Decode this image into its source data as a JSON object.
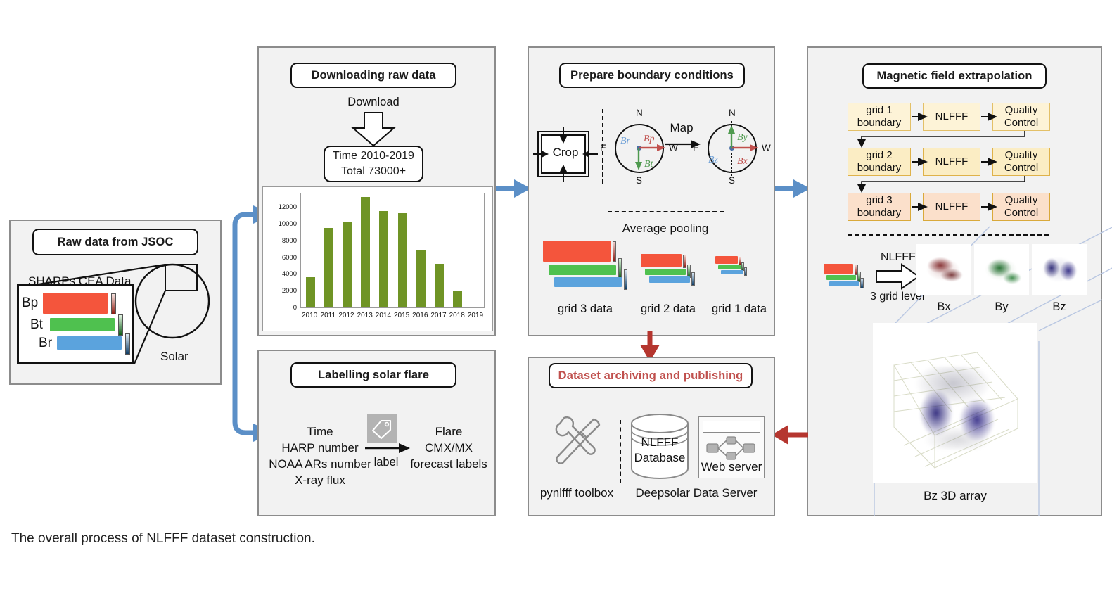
{
  "caption": "The overall process of NLFFF dataset construction.",
  "colors": {
    "panel_bg": "#f2f2f2",
    "panel_border": "#8c8c8c",
    "blue_arrow": "#5b8fc7",
    "red_arrow": "#b5362f",
    "bar_green": "#6f9425",
    "title_red": "#c0504d",
    "grid1_fill": "#fdf3d7",
    "grid2_fill": "#fbedc4",
    "grid3_fill": "#fbe0cb",
    "grid_border": "#d9a93a",
    "band_bp": "#f4553c",
    "band_bt": "#4fc14f",
    "band_br": "#5ba3dd"
  },
  "panels": {
    "raw": {
      "title": "Raw data from JSOC",
      "subtitle": "SHARPs CEA Data",
      "bands": [
        "Bp",
        "Bt",
        "Br"
      ],
      "solar_label": "Solar"
    },
    "download": {
      "title": "Downloading raw data",
      "arrow_label": "Download",
      "summary_line1": "Time 2010-2019",
      "summary_line2": "Total  73000+"
    },
    "boundary": {
      "title": "Prepare boundary conditions",
      "crop_label": "Crop",
      "map_label": "Map",
      "pooling_label": "Average pooling",
      "compass_left": {
        "north": "N",
        "south": "S",
        "east": "E",
        "west": "W",
        "v_up": "Br",
        "v_right": "Bp",
        "v_down": "Bt"
      },
      "compass_right": {
        "north": "N",
        "south": "S",
        "east": "E",
        "west": "W",
        "v_up": "By",
        "v_right": "Bx",
        "v_down": "Bz"
      },
      "grid_labels": [
        "grid 3 data",
        "grid 2 data",
        "grid 1 data"
      ]
    },
    "extrapolation": {
      "title": "Magnetic field extrapolation",
      "rows": [
        {
          "boundary": "grid 1\nboundary",
          "boundary_l1": "grid 1",
          "boundary_l2": "boundary",
          "method": "NLFFF",
          "qc_l1": "Quality",
          "qc_l2": "Control"
        },
        {
          "boundary_l1": "grid 2",
          "boundary_l2": "boundary",
          "method": "NLFFF",
          "qc_l1": "Quality",
          "qc_l2": "Control"
        },
        {
          "boundary_l1": "grid 3",
          "boundary_l2": "boundary",
          "method": "NLFFF",
          "qc_l1": "Quality",
          "qc_l2": "Control"
        }
      ],
      "nlfff_arrow_top": "NLFFF",
      "nlfff_arrow_bottom": "3 grid level",
      "volume_labels": [
        "Bx",
        "By",
        "Bz"
      ],
      "bz_caption": "Bz  3D  array"
    },
    "labelling": {
      "title": "Labelling solar flare",
      "inputs": [
        "Time",
        "HARP number",
        "NOAA ARs number",
        "X-ray flux"
      ],
      "arrow_label": "label",
      "outputs": [
        "Flare",
        "CMX/MX",
        "forecast labels"
      ],
      "icon": "tag-icon"
    },
    "archiving": {
      "title": "Dataset archiving and publishing",
      "toolbox_label": "pynlfff toolbox",
      "server_label": "Deepsolar Data Server",
      "db_l1": "NLFFF",
      "db_l2": "Database",
      "web_label": "Web server"
    }
  },
  "chart_data": {
    "type": "bar",
    "title": "",
    "xlabel": "",
    "ylabel": "",
    "categories": [
      "2010",
      "2011",
      "2012",
      "2013",
      "2014",
      "2015",
      "2016",
      "2017",
      "2018",
      "2019"
    ],
    "values": [
      3650,
      9550,
      10200,
      13250,
      11550,
      11250,
      6850,
      5200,
      1950,
      100
    ],
    "yticks": [
      0,
      2000,
      4000,
      6000,
      8000,
      10000,
      12000
    ],
    "ylim": [
      0,
      13800
    ],
    "grid": false,
    "legend": "none",
    "color": "#6f9425"
  }
}
